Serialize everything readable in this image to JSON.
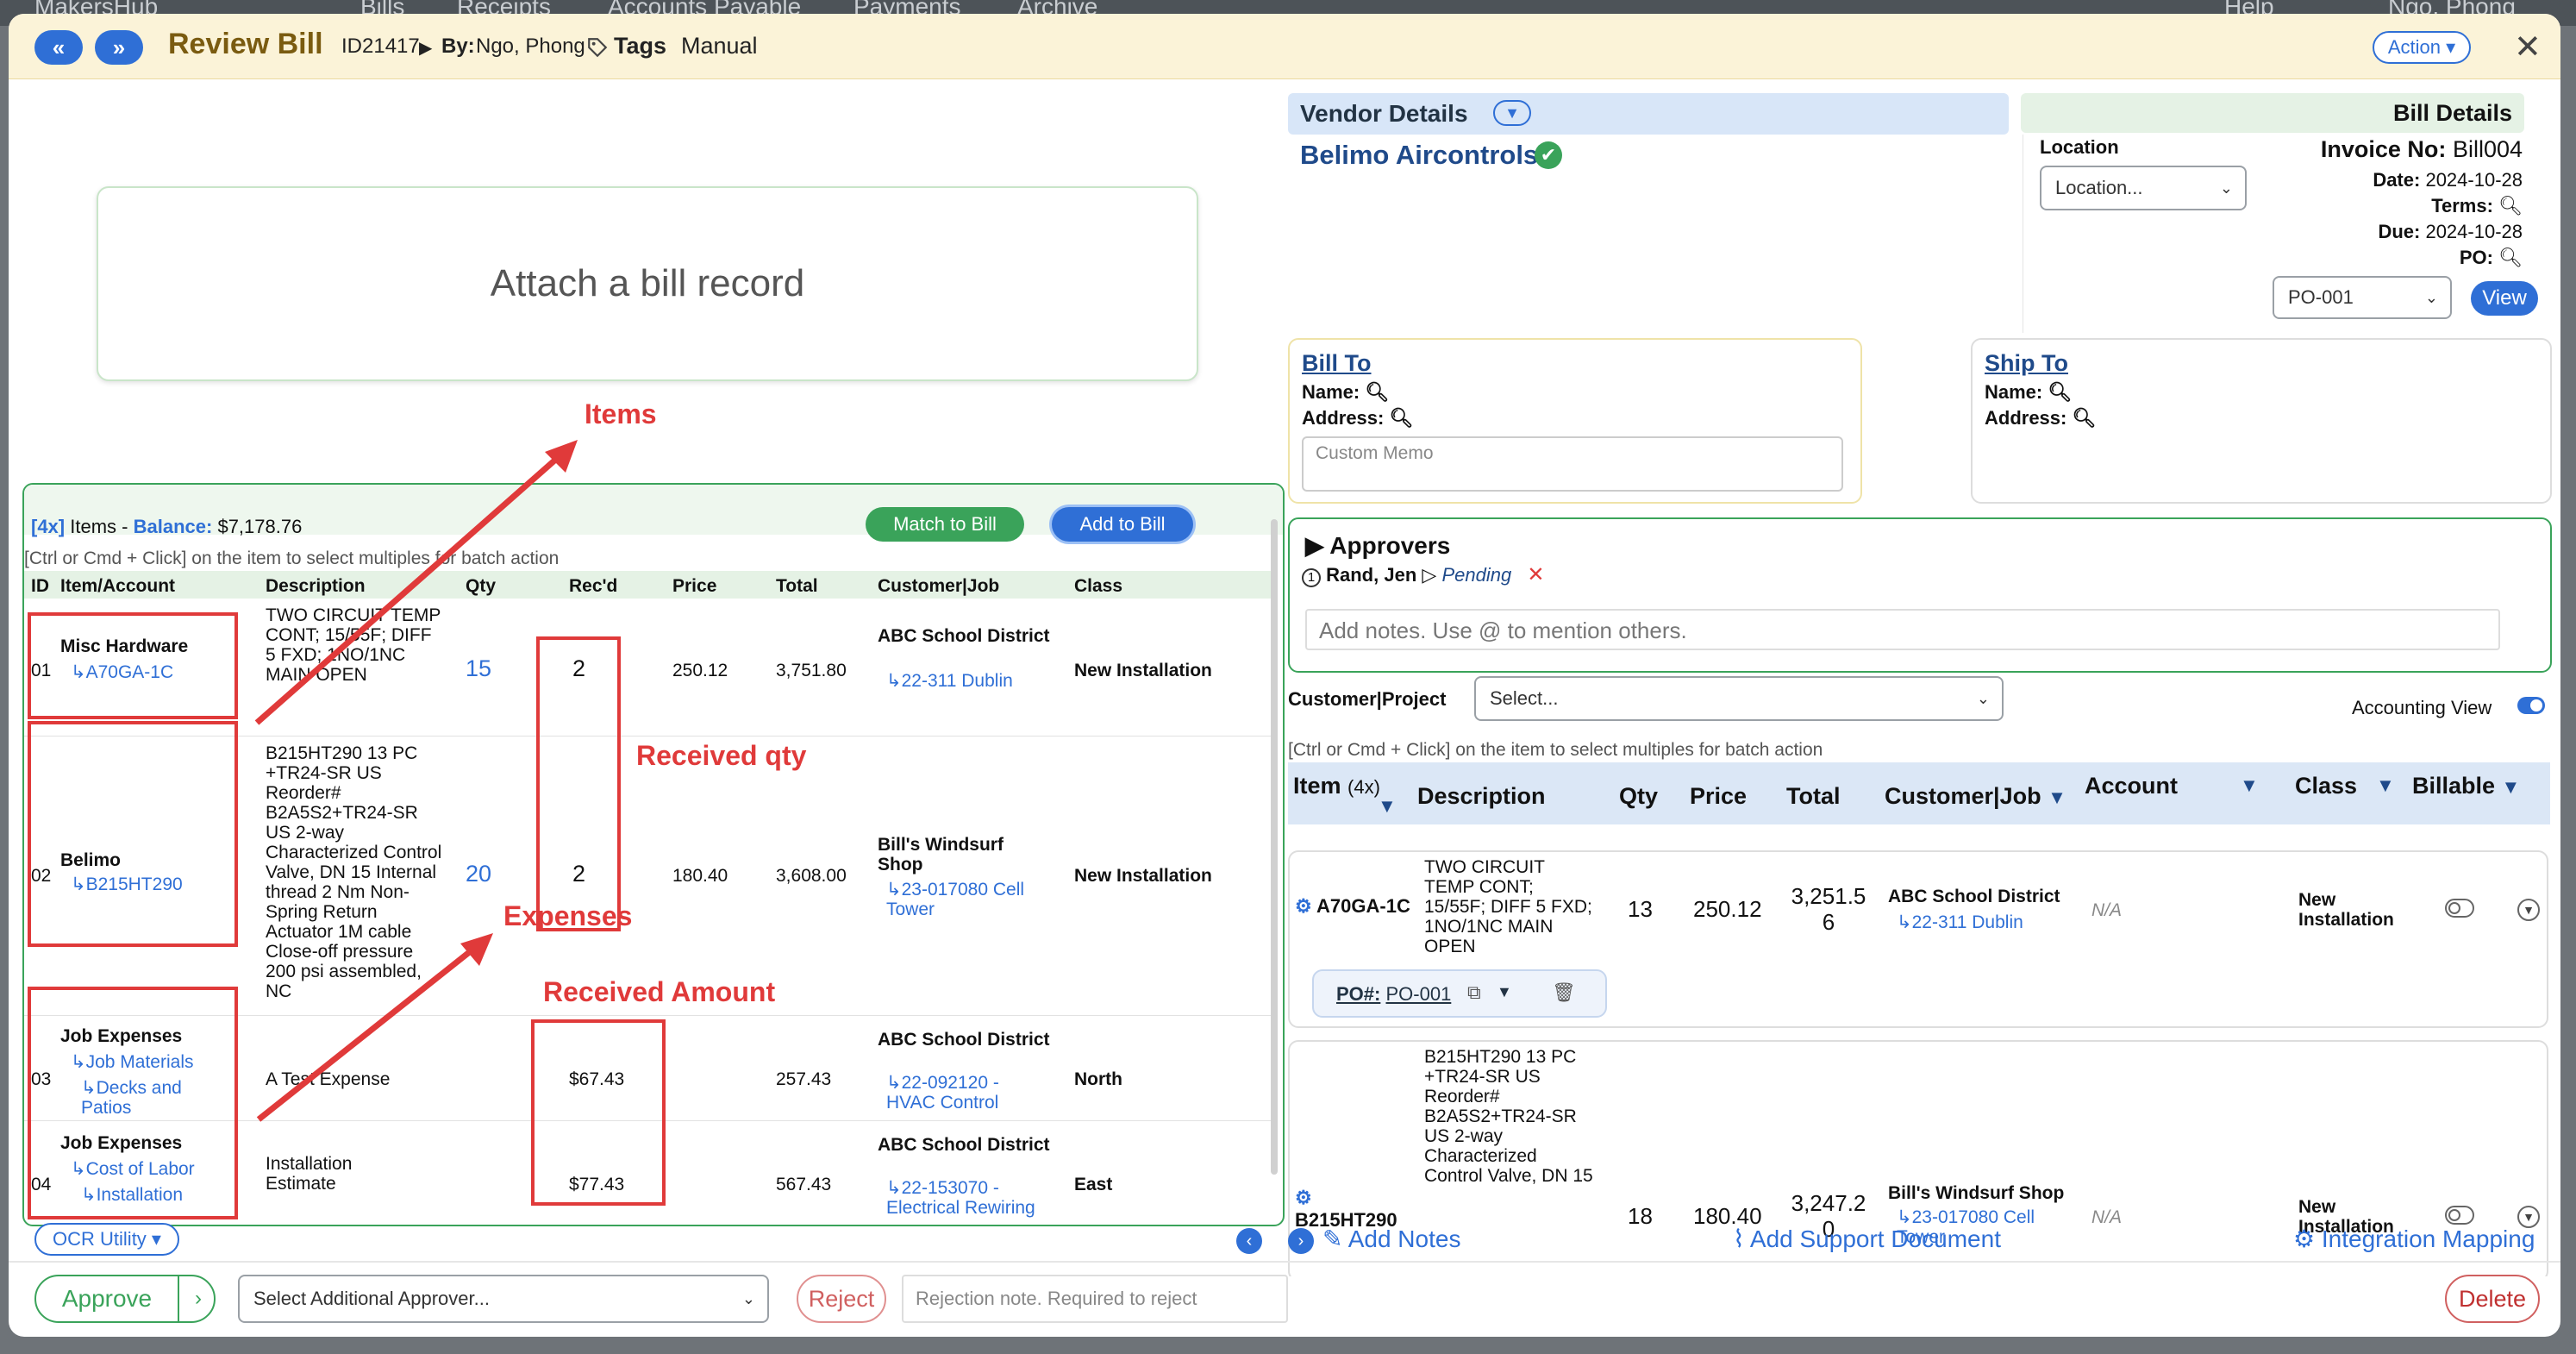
{
  "bg_nav": {
    "brand": "MakersHub",
    "tabs": [
      "Bills",
      "Receipts",
      "Accounts Payable",
      "Payments",
      "Archive"
    ],
    "help": "Help",
    "user": "Ngo, Phong"
  },
  "titlebar": {
    "title": "Review Bill",
    "id": "ID21417",
    "by_label": "By:",
    "by_name": "Ngo, Phong",
    "tags": "Tags",
    "manual": "Manual",
    "action": "Action"
  },
  "attach": {
    "text": "Attach a bill record"
  },
  "annotations": {
    "items": "Items",
    "received_qty": "Received qty",
    "expenses": "Expenses",
    "received_amount": "Received Amount"
  },
  "left": {
    "count": "[4x]",
    "items_label": "Items -",
    "balance_label": "Balance:",
    "balance": "$7,178.76",
    "match_btn": "Match to Bill",
    "add_btn": "Add to Bill",
    "hint": "[Ctrl or Cmd + Click] on the item to select multiples for batch action",
    "columns": [
      "ID",
      "Item/Account",
      "Description",
      "Qty",
      "Rec'd",
      "Price",
      "Total",
      "Customer|Job",
      "Class"
    ],
    "rows": [
      {
        "id": "01",
        "item": "Misc Hardware",
        "sub": [
          "↳A70GA-1C"
        ],
        "desc": "TWO CIRCUIT TEMP CONT; 15/55F; DIFF 5 FXD; 1NO/1NC MAIN OPEN",
        "qty": "15",
        "recd": "2",
        "price": "250.12",
        "total": "3,751.80",
        "cust": "ABC School District",
        "job": "↳22-311 Dublin",
        "class": "New Installation"
      },
      {
        "id": "02",
        "item": "Belimo",
        "sub": [
          "↳B215HT290"
        ],
        "desc": "B215HT290 13 PC +TR24-SR US Reorder# B2A5S2+TR24-SR US 2-way Characterized Control Valve, DN 15 Internal thread 2 Nm Non-Spring Return Actuator 1M cable Close-off pressure 200 psi assembled, NC",
        "qty": "20",
        "recd": "2",
        "price": "180.40",
        "total": "3,608.00",
        "cust": "Bill's Windsurf Shop",
        "job": "↳23-017080 Cell Tower",
        "class": "New Installation"
      },
      {
        "id": "03",
        "item": "Job Expenses",
        "sub": [
          "↳Job Materials",
          "↳Decks and Patios"
        ],
        "desc": "A Test Expense",
        "qty": "",
        "recd": "$67.43",
        "price": "",
        "total": "257.43",
        "cust": "ABC School District",
        "job": "↳22-092120 - HVAC Control",
        "class": "North"
      },
      {
        "id": "04",
        "item": "Job Expenses",
        "sub": [
          "↳Cost of Labor",
          "↳Installation"
        ],
        "desc": "Installation Estimate",
        "qty": "",
        "recd": "$77.43",
        "price": "",
        "total": "567.43",
        "cust": "ABC School District",
        "job": "↳22-153070 - Electrical Rewiring",
        "class": "East"
      }
    ]
  },
  "vendor": {
    "header": "Vendor Details",
    "name": "Belimo Aircontrols"
  },
  "bill_details": {
    "header": "Bill Details",
    "location_label": "Location",
    "location_placeholder": "Location...",
    "invoice_label": "Invoice No:",
    "invoice": "Bill004",
    "date_label": "Date:",
    "date": "2024-10-28",
    "terms_label": "Terms:",
    "due_label": "Due:",
    "due": "2024-10-28",
    "po_label": "PO:",
    "po_value": "PO-001",
    "view": "View"
  },
  "bill_to": {
    "title": "Bill To",
    "name": "Name:",
    "address": "Address:",
    "memo": "Custom Memo"
  },
  "ship_to": {
    "title": "Ship To",
    "name": "Name:",
    "address": "Address:"
  },
  "approvers": {
    "title": "Approvers",
    "index": "1",
    "name": "Rand, Jen",
    "status": "Pending",
    "notes_placeholder": "Add notes. Use @ to mention others."
  },
  "customer_project": {
    "label": "Customer|Project",
    "placeholder": "Select...",
    "accounting_view": "Accounting View"
  },
  "right": {
    "hint": "[Ctrl or Cmd + Click] on the item to select multiples for batch action",
    "columns": {
      "item": "Item",
      "count": "(4x)",
      "desc": "Description",
      "qty": "Qty",
      "price": "Price",
      "total": "Total",
      "cust": "Customer|Job",
      "account": "Account",
      "class": "Class",
      "billable": "Billable"
    },
    "rows": [
      {
        "item": "A70GA-1C",
        "desc": "TWO CIRCUIT TEMP CONT; 15/55F; DIFF 5 FXD; 1NO/1NC MAIN OPEN",
        "qty": "13",
        "price": "250.12",
        "total": "3,251.5 6",
        "cust": "ABC School District",
        "job": "↳22-311 Dublin",
        "account": "N/A",
        "class": "New Installation",
        "po_label": "PO#:",
        "po": "PO-001"
      },
      {
        "item": "B215HT290",
        "desc": "B215HT290 13 PC +TR24-SR US Reorder# B2A5S2+TR24-SR US 2-way Characterized Control Valve, DN 15",
        "qty": "18",
        "price": "180.40",
        "total": "3,247.2 0",
        "cust": "Bill's Windsurf Shop",
        "job": "↳23-017080 Cell Tower",
        "account": "N/A",
        "class": "New Installation"
      }
    ]
  },
  "bottom": {
    "ocr": "OCR Utility",
    "add_notes": "Add Notes",
    "support": "Add Support Document",
    "integration": "Integration Mapping",
    "approve": "Approve",
    "approver_placeholder": "Select Additional Approver...",
    "reject": "Reject",
    "reject_placeholder": "Rejection note. Required to reject",
    "delete": "Delete"
  },
  "colors": {
    "accent": "#2f6fd6",
    "green": "#3aa35a",
    "annotation": "#e03a3a",
    "title": "#7a5b10"
  }
}
